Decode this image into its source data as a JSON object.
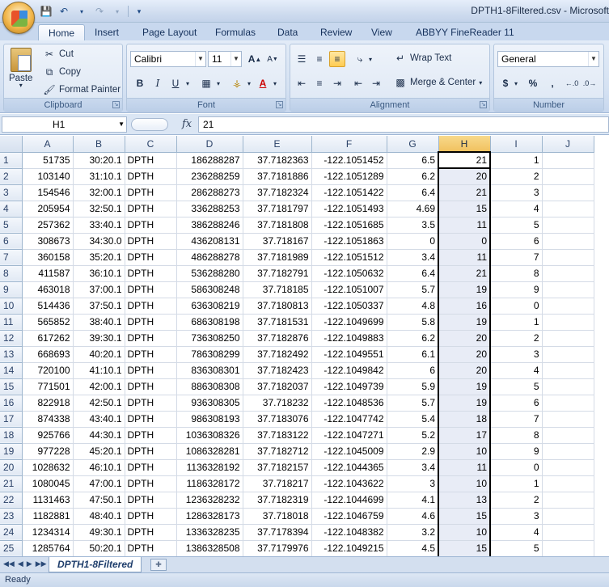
{
  "window": {
    "title": "DPTH1-8Filtered.csv - Microsoft"
  },
  "ribbon_tabs": [
    "Home",
    "Insert",
    "Page Layout",
    "Formulas",
    "Data",
    "Review",
    "View",
    "ABBYY FineReader 11"
  ],
  "clipboard": {
    "paste": "Paste",
    "cut": "Cut",
    "copy": "Copy",
    "format_painter": "Format Painter",
    "label": "Clipboard"
  },
  "font": {
    "name": "Calibri",
    "size": "11",
    "bold": "B",
    "italic": "I",
    "underline": "U",
    "label": "Font"
  },
  "alignment": {
    "wrap_text": "Wrap Text",
    "merge_center": "Merge & Center",
    "label": "Alignment"
  },
  "number": {
    "format": "General",
    "currency": "$",
    "percent": "%",
    "comma": ",",
    "label": "Number"
  },
  "formula_bar": {
    "name_box": "H1",
    "fx": "fx",
    "value": "21"
  },
  "columns": [
    "A",
    "B",
    "C",
    "D",
    "E",
    "F",
    "G",
    "H",
    "I",
    "J"
  ],
  "rows": [
    {
      "n": "1",
      "a": "51735",
      "b": "30:20.1",
      "c": "DPTH",
      "d": "186288287",
      "e": "37.7182363",
      "f": "-122.1051452",
      "g": "6.5",
      "h": "21",
      "i": "1"
    },
    {
      "n": "2",
      "a": "103140",
      "b": "31:10.1",
      "c": "DPTH",
      "d": "236288259",
      "e": "37.7181886",
      "f": "-122.1051289",
      "g": "6.2",
      "h": "20",
      "i": "2"
    },
    {
      "n": "3",
      "a": "154546",
      "b": "32:00.1",
      "c": "DPTH",
      "d": "286288273",
      "e": "37.7182324",
      "f": "-122.1051422",
      "g": "6.4",
      "h": "21",
      "i": "3"
    },
    {
      "n": "4",
      "a": "205954",
      "b": "32:50.1",
      "c": "DPTH",
      "d": "336288253",
      "e": "37.7181797",
      "f": "-122.1051493",
      "g": "4.69",
      "h": "15",
      "i": "4"
    },
    {
      "n": "5",
      "a": "257362",
      "b": "33:40.1",
      "c": "DPTH",
      "d": "386288246",
      "e": "37.7181808",
      "f": "-122.1051685",
      "g": "3.5",
      "h": "11",
      "i": "5"
    },
    {
      "n": "6",
      "a": "308673",
      "b": "34:30.0",
      "c": "DPTH",
      "d": "436208131",
      "e": "37.718167",
      "f": "-122.1051863",
      "g": "0",
      "h": "0",
      "i": "6"
    },
    {
      "n": "7",
      "a": "360158",
      "b": "35:20.1",
      "c": "DPTH",
      "d": "486288278",
      "e": "37.7181989",
      "f": "-122.1051512",
      "g": "3.4",
      "h": "11",
      "i": "7"
    },
    {
      "n": "8",
      "a": "411587",
      "b": "36:10.1",
      "c": "DPTH",
      "d": "536288280",
      "e": "37.7182791",
      "f": "-122.1050632",
      "g": "6.4",
      "h": "21",
      "i": "8"
    },
    {
      "n": "9",
      "a": "463018",
      "b": "37:00.1",
      "c": "DPTH",
      "d": "586308248",
      "e": "37.718185",
      "f": "-122.1051007",
      "g": "5.7",
      "h": "19",
      "i": "9"
    },
    {
      "n": "10",
      "a": "514436",
      "b": "37:50.1",
      "c": "DPTH",
      "d": "636308219",
      "e": "37.7180813",
      "f": "-122.1050337",
      "g": "4.8",
      "h": "16",
      "i": "0"
    },
    {
      "n": "11",
      "a": "565852",
      "b": "38:40.1",
      "c": "DPTH",
      "d": "686308198",
      "e": "37.7181531",
      "f": "-122.1049699",
      "g": "5.8",
      "h": "19",
      "i": "1"
    },
    {
      "n": "12",
      "a": "617262",
      "b": "39:30.1",
      "c": "DPTH",
      "d": "736308250",
      "e": "37.7182876",
      "f": "-122.1049883",
      "g": "6.2",
      "h": "20",
      "i": "2"
    },
    {
      "n": "13",
      "a": "668693",
      "b": "40:20.1",
      "c": "DPTH",
      "d": "786308299",
      "e": "37.7182492",
      "f": "-122.1049551",
      "g": "6.1",
      "h": "20",
      "i": "3"
    },
    {
      "n": "14",
      "a": "720100",
      "b": "41:10.1",
      "c": "DPTH",
      "d": "836308301",
      "e": "37.7182423",
      "f": "-122.1049842",
      "g": "6",
      "h": "20",
      "i": "4"
    },
    {
      "n": "15",
      "a": "771501",
      "b": "42:00.1",
      "c": "DPTH",
      "d": "886308308",
      "e": "37.7182037",
      "f": "-122.1049739",
      "g": "5.9",
      "h": "19",
      "i": "5"
    },
    {
      "n": "16",
      "a": "822918",
      "b": "42:50.1",
      "c": "DPTH",
      "d": "936308305",
      "e": "37.718232",
      "f": "-122.1048536",
      "g": "5.7",
      "h": "19",
      "i": "6"
    },
    {
      "n": "17",
      "a": "874338",
      "b": "43:40.1",
      "c": "DPTH",
      "d": "986308193",
      "e": "37.7183076",
      "f": "-122.1047742",
      "g": "5.4",
      "h": "18",
      "i": "7"
    },
    {
      "n": "18",
      "a": "925766",
      "b": "44:30.1",
      "c": "DPTH",
      "d": "1036308326",
      "e": "37.7183122",
      "f": "-122.1047271",
      "g": "5.2",
      "h": "17",
      "i": "8"
    },
    {
      "n": "19",
      "a": "977228",
      "b": "45:20.1",
      "c": "DPTH",
      "d": "1086328281",
      "e": "37.7182712",
      "f": "-122.1045009",
      "g": "2.9",
      "h": "10",
      "i": "9"
    },
    {
      "n": "20",
      "a": "1028632",
      "b": "46:10.1",
      "c": "DPTH",
      "d": "1136328192",
      "e": "37.7182157",
      "f": "-122.1044365",
      "g": "3.4",
      "h": "11",
      "i": "0"
    },
    {
      "n": "21",
      "a": "1080045",
      "b": "47:00.1",
      "c": "DPTH",
      "d": "1186328172",
      "e": "37.718217",
      "f": "-122.1043622",
      "g": "3",
      "h": "10",
      "i": "1"
    },
    {
      "n": "22",
      "a": "1131463",
      "b": "47:50.1",
      "c": "DPTH",
      "d": "1236328232",
      "e": "37.7182319",
      "f": "-122.1044699",
      "g": "4.1",
      "h": "13",
      "i": "2"
    },
    {
      "n": "23",
      "a": "1182881",
      "b": "48:40.1",
      "c": "DPTH",
      "d": "1286328173",
      "e": "37.718018",
      "f": "-122.1046759",
      "g": "4.6",
      "h": "15",
      "i": "3"
    },
    {
      "n": "24",
      "a": "1234314",
      "b": "49:30.1",
      "c": "DPTH",
      "d": "1336328235",
      "e": "37.7178394",
      "f": "-122.1048382",
      "g": "3.2",
      "h": "10",
      "i": "4"
    },
    {
      "n": "25",
      "a": "1285764",
      "b": "50:20.1",
      "c": "DPTH",
      "d": "1386328508",
      "e": "37.7179976",
      "f": "-122.1049215",
      "g": "4.5",
      "h": "15",
      "i": "5"
    }
  ],
  "sheet_tab": "DPTH1-8Filtered",
  "status": "Ready"
}
